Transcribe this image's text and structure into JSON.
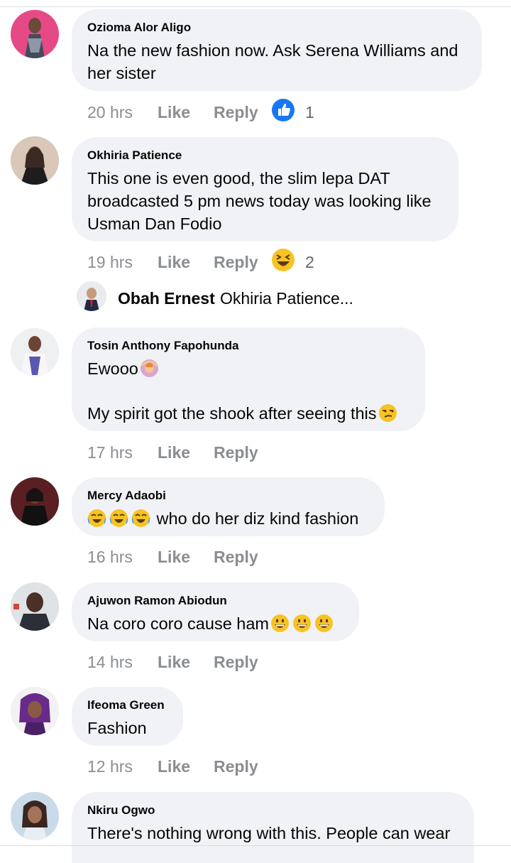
{
  "comments": [
    {
      "author": "Ozioma Alor Aligo",
      "text": "Na the new fashion now. Ask Serena Williams and her sister",
      "time": "20 hrs",
      "like": "Like",
      "reply": "Reply",
      "reaction_icon": "thumbs-up-reaction-icon",
      "reaction_count": "1"
    },
    {
      "author": "Okhiria Patience",
      "text": "This one is even good, the slim lepa DAT broadcasted 5 pm news today was looking like Usman Dan Fodio",
      "time": "19 hrs",
      "like": "Like",
      "reply": "Reply",
      "reaction_icon": "haha-reaction-icon",
      "reaction_count": "2"
    },
    {
      "author": "Tosin Anthony Fapohunda",
      "text": "Ewooo",
      "text2": "My spirit got the shook after seeing this",
      "time": "17 hrs",
      "like": "Like",
      "reply": "Reply"
    },
    {
      "author": "Mercy Adaobi",
      "text": "who do her diz kind fashion",
      "time": "16 hrs",
      "like": "Like",
      "reply": "Reply"
    },
    {
      "author": "Ajuwon Ramon Abiodun",
      "text": "Na coro coro cause ham",
      "time": "14 hrs",
      "like": "Like",
      "reply": "Reply"
    },
    {
      "author": "Ifeoma Green",
      "text": "Fashion",
      "time": "12 hrs",
      "like": "Like",
      "reply": "Reply"
    },
    {
      "author": "Nkiru Ogwo",
      "text": "There's nothing wrong with this. People can wear"
    }
  ],
  "reply_preview": {
    "author": "Obah Ernest",
    "text": "Okhiria Patience..."
  },
  "colors": {
    "bubble": "#f0f2f5",
    "meta": "#8a8d91",
    "like_blue": "#1877f2"
  }
}
